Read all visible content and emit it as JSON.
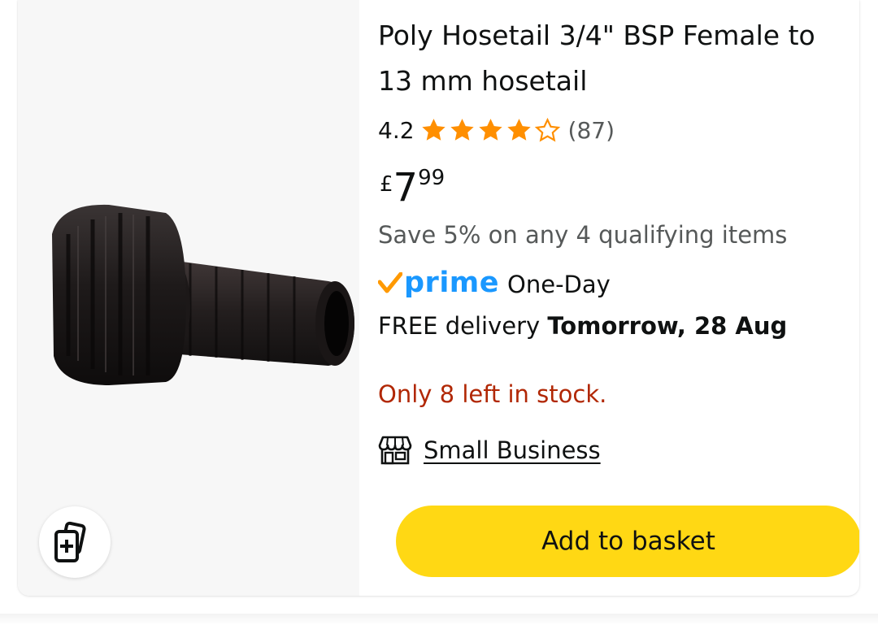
{
  "product": {
    "title": "Poly Hosetail 3/4\" BSP Female to 13 mm hosetail",
    "rating": {
      "value": "4.2",
      "stars_out_of_5": 4.2,
      "count": "(87)"
    },
    "price": {
      "currency": "£",
      "whole": "7",
      "fraction": "99"
    },
    "promotion": "Save 5% on any 4 qualifying items",
    "prime": {
      "logo_text": "prime",
      "label": "One-Day"
    },
    "delivery": {
      "prefix": "FREE delivery",
      "date": "Tomorrow, 28 Aug"
    },
    "stock": "Only 8 left in stock.",
    "badge": {
      "label": "Small Business",
      "icon": "storefront-icon"
    },
    "add_to_basket_label": "Add to basket"
  },
  "icons": {
    "compare": "add-to-compare-icon",
    "star_full": "star-full-icon",
    "star_empty": "star-empty-icon",
    "prime_check": "prime-check-icon"
  },
  "colors": {
    "star": "#ff8f00",
    "prime_blue": "#1a98ff",
    "prime_check": "#ff9900",
    "stock_red": "#b12704",
    "button_yellow": "#ffd814",
    "muted_text": "#565959"
  }
}
